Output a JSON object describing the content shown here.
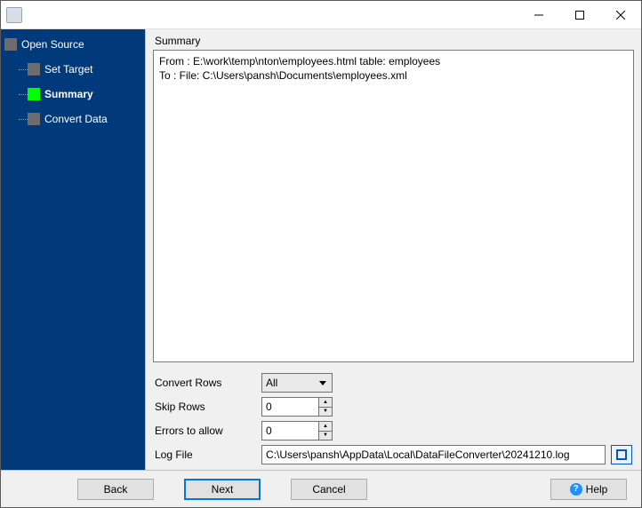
{
  "window": {
    "title": ""
  },
  "sidebar": {
    "items": [
      {
        "label": "Open Source",
        "active": false
      },
      {
        "label": "Set Target",
        "active": false
      },
      {
        "label": "Summary",
        "active": true
      },
      {
        "label": "Convert Data",
        "active": false
      }
    ]
  },
  "summary": {
    "title": "Summary",
    "text": "From : E:\\work\\temp\\nton\\employees.html table: employees\nTo : File: C:\\Users\\pansh\\Documents\\employees.xml"
  },
  "controls": {
    "convert_rows_label": "Convert Rows",
    "convert_rows_value": "All",
    "skip_rows_label": "Skip Rows",
    "skip_rows_value": "0",
    "errors_label": "Errors to allow",
    "errors_value": "0",
    "logfile_label": "Log File",
    "logfile_value": "C:\\Users\\pansh\\AppData\\Local\\DataFileConverter\\20241210.log"
  },
  "footer": {
    "back": "Back",
    "next": "Next",
    "cancel": "Cancel",
    "help": "Help"
  }
}
